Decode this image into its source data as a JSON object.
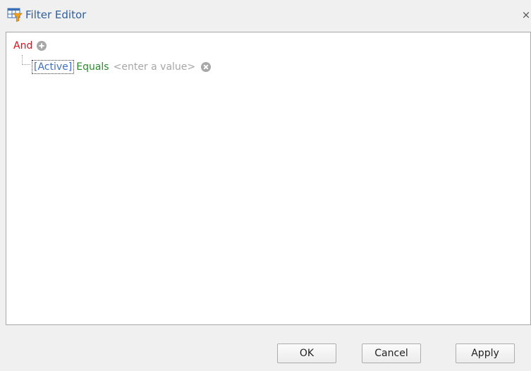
{
  "window": {
    "title": "Filter Editor",
    "close_glyph": "×",
    "title_icon": "filter-editor-icon"
  },
  "filter": {
    "group_operator": "And",
    "group_operator_color": "#d4121c",
    "add_icon": "add-circle-icon",
    "conditions": [
      {
        "field": "[Active]",
        "field_color": "#3f6fc2",
        "operator": "Equals",
        "operator_color": "#2b8a2b",
        "value_placeholder": "<enter a value>",
        "remove_icon": "remove-circle-icon"
      }
    ]
  },
  "buttons": {
    "ok": "OK",
    "cancel": "Cancel",
    "apply": "Apply"
  }
}
